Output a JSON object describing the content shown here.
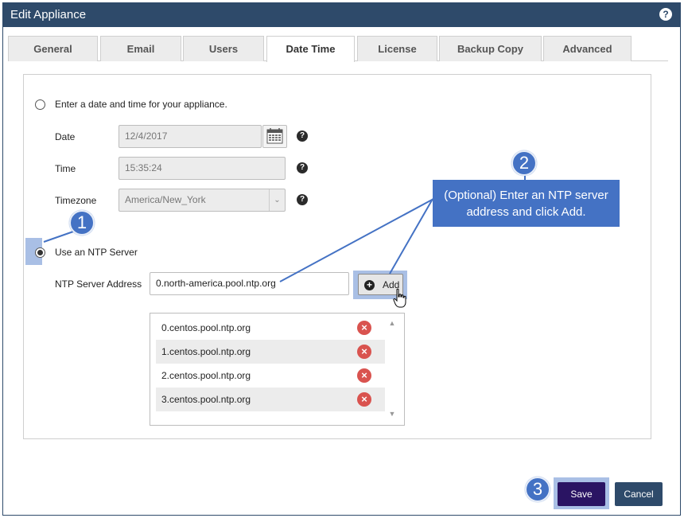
{
  "window": {
    "title": "Edit Appliance",
    "help_symbol": "?"
  },
  "tabs": [
    {
      "label": "General"
    },
    {
      "label": "Email"
    },
    {
      "label": "Users"
    },
    {
      "label": "Date Time",
      "active": true
    },
    {
      "label": "License"
    },
    {
      "label": "Backup Copy"
    },
    {
      "label": "Advanced"
    }
  ],
  "manual": {
    "radio_label": "Enter a date and time for your appliance.",
    "date_label": "Date",
    "date_value": "12/4/2017",
    "time_label": "Time",
    "time_value": "15:35:24",
    "timezone_label": "Timezone",
    "timezone_value": "America/New_York",
    "help_symbol": "?"
  },
  "ntp": {
    "radio_label": "Use an NTP Server",
    "address_label": "NTP Server Address",
    "address_value": "0.north-america.pool.ntp.org",
    "add_label": "Add",
    "servers": [
      "0.centos.pool.ntp.org",
      "1.centos.pool.ntp.org",
      "2.centos.pool.ntp.org",
      "3.centos.pool.ntp.org"
    ]
  },
  "callouts": {
    "one": "1",
    "two": "2",
    "three": "3",
    "two_text": "(Optional) Enter an NTP server address and click Add."
  },
  "footer": {
    "save_label": "Save",
    "cancel_label": "Cancel"
  },
  "colors": {
    "titlebar": "#2e4a6a",
    "callout": "#4472c4",
    "highlight": "#a9bfe5",
    "save": "#2a1463",
    "delete": "#d9534f"
  },
  "icons": {
    "calendar": "calendar-icon",
    "help": "help-icon",
    "delete": "remove-icon",
    "add": "plus-icon",
    "cursor": "hand-cursor-icon"
  }
}
